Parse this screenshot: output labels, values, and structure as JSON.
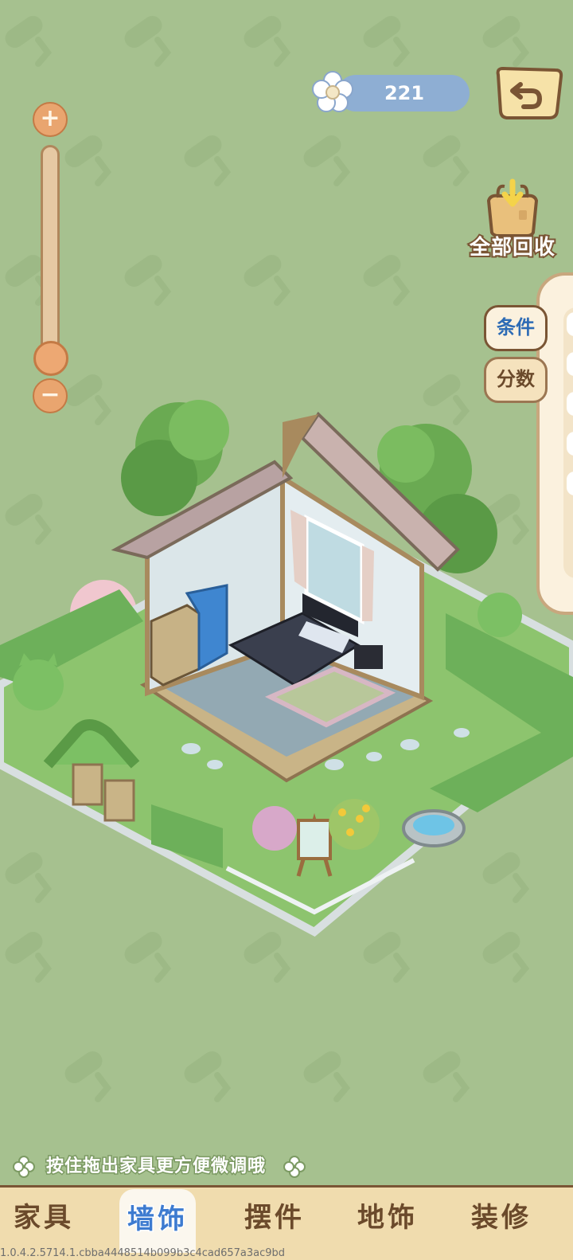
{
  "currency": {
    "icon": "flower-icon",
    "amount": "221",
    "pill_color": "#8eaed3"
  },
  "back_button": {
    "icon": "undo-arrow-icon"
  },
  "zoom": {
    "plus_label": "+",
    "minus_label": "−",
    "level": 0.1
  },
  "recycle_all": {
    "icon": "recycle-bag-icon",
    "label": "全部回收"
  },
  "side_panel": {
    "tabs": [
      {
        "label": "条件",
        "active": true
      },
      {
        "label": "分数",
        "active": false
      }
    ]
  },
  "hint": {
    "text": "按住拖出家具更方便微调哦",
    "icon": "clover-icon"
  },
  "bottom_nav": {
    "tabs": [
      {
        "label": "家具",
        "active": false
      },
      {
        "label": "墙饰",
        "active": true
      },
      {
        "label": "摆件",
        "active": false
      },
      {
        "label": "地饰",
        "active": false
      },
      {
        "label": "装修",
        "active": false
      }
    ]
  },
  "version": "1.0.4.2.5714.1.cbba4448514b099b3c4cad657a3ac9bd",
  "colors": {
    "background": "#a6c18f",
    "accent_blue": "#3d7bd0",
    "brown": "#7a5534",
    "nav_bg": "#f0dcae"
  }
}
